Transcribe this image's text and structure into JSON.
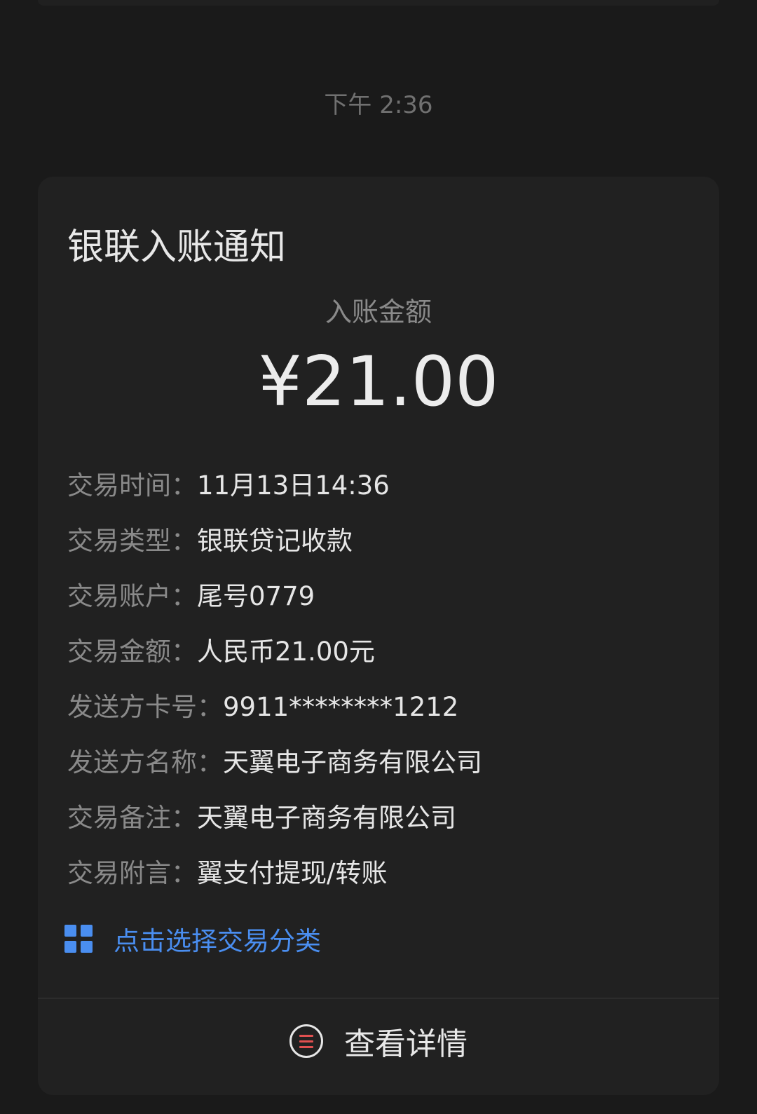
{
  "message": {
    "timestamp": "下午 2:36"
  },
  "card": {
    "title": "银联入账通知",
    "amount_label": "入账金额",
    "amount_value": "¥21.00",
    "details": [
      {
        "label": "交易时间：",
        "value": "11月13日14:36"
      },
      {
        "label": "交易类型：",
        "value": "银联贷记收款"
      },
      {
        "label": "交易账户：",
        "value": "尾号0779"
      },
      {
        "label": "交易金额：",
        "value": "人民币21.00元"
      },
      {
        "label": "发送方卡号：",
        "value": "9911********1212"
      },
      {
        "label": "发送方名称：",
        "value": "天翼电子商务有限公司"
      },
      {
        "label": "交易备注：",
        "value": "天翼电子商务有限公司"
      },
      {
        "label": "交易附言：",
        "value": "翼支付提现/转账"
      }
    ],
    "category_link": {
      "icon": "grid-icon",
      "label": "点击选择交易分类"
    },
    "detail_button": {
      "icon": "list-circle-icon",
      "label": "查看详情"
    }
  },
  "colors": {
    "background": "#1a1a1a",
    "card": "#212121",
    "accent": "#4a8ef0",
    "detail_icon_lines": "#e05050"
  }
}
